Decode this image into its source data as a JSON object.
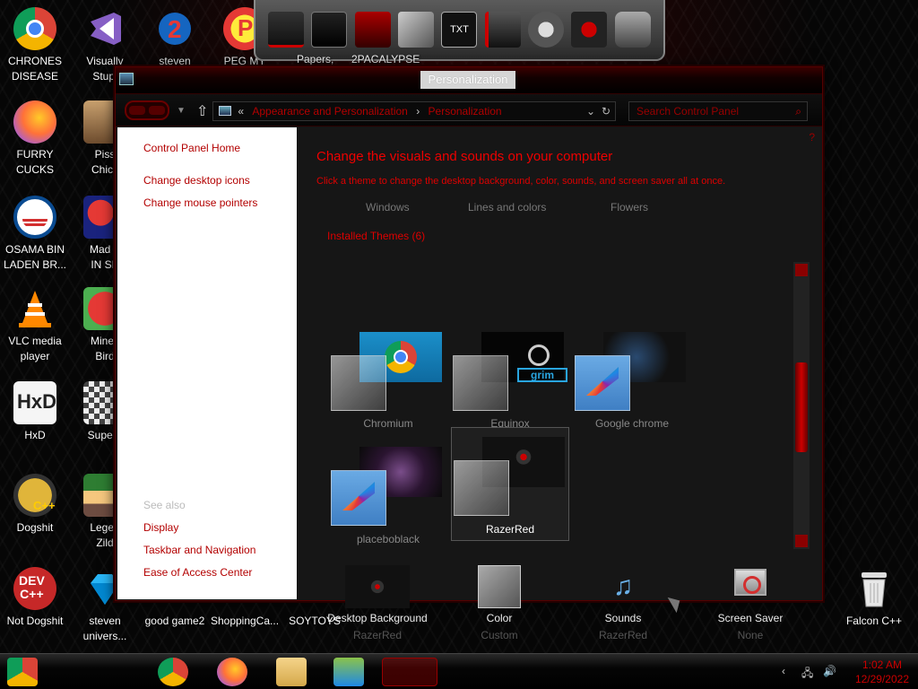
{
  "desktop": {
    "icons": [
      {
        "label": "CHRONES\nDISEASE",
        "icon": "chrome-icon"
      },
      {
        "label": "Visually\nStupi",
        "icon": "visual-studio-icon"
      },
      {
        "label": "steven",
        "icon": "steven-icon"
      },
      {
        "label": "PEG MY",
        "icon": "peg-icon"
      },
      {
        "label": "FURRY\nCUCKS",
        "icon": "firefox-icon"
      },
      {
        "label": "Piss\nChick",
        "icon": "piss-chick-icon"
      },
      {
        "label": "OSAMA BIN\nLADEN BR...",
        "icon": "obama-logo-icon"
      },
      {
        "label": "Mad A\nIN SP",
        "icon": "angry-birds-space-icon"
      },
      {
        "label": "VLC media\nplayer",
        "icon": "vlc-icon"
      },
      {
        "label": "Minec\nBird",
        "icon": "angry-bird-icon"
      },
      {
        "label": "HxD",
        "icon": "hxd-icon"
      },
      {
        "label": "Super I",
        "icon": "super-icon"
      },
      {
        "label": "Dogshit",
        "icon": "dogshit-icon"
      },
      {
        "label": "Legen\nZild",
        "icon": "zelda-icon"
      },
      {
        "label": "Not Dogshit",
        "icon": "dev-cpp-icon"
      },
      {
        "label": "steven\nunivers...",
        "icon": "gem-icon"
      },
      {
        "label": "good game2",
        "icon": "file-icon"
      },
      {
        "label": "ShoppingCa...",
        "icon": "file-icon"
      },
      {
        "label": "SOYTOYS",
        "icon": "file-icon"
      },
      {
        "label": "Falcon C++",
        "icon": "recycle-bin-icon"
      }
    ],
    "dock_labels": [
      "Papers,",
      "2PACALYPSE"
    ]
  },
  "window": {
    "title": "Personalization",
    "breadcrumb": {
      "prefix": "«",
      "items": [
        "Appearance and Personalization",
        "Personalization"
      ]
    },
    "search_placeholder": "Search Control Panel"
  },
  "leftpane": {
    "home": "Control Panel Home",
    "links": [
      "Change desktop icons",
      "Change mouse pointers"
    ],
    "see_also": "See also",
    "see_also_links": [
      "Display",
      "Taskbar and Navigation",
      "Ease of Access Center"
    ]
  },
  "main": {
    "help_icon": "?",
    "heading": "Change the visuals and sounds on your computer",
    "subheading": "Click a theme to change the desktop background, color, sounds, and screen saver all at once.",
    "categories": [
      "Windows",
      "Lines and colors",
      "Flowers"
    ],
    "installed_label": "Installed Themes (6)",
    "themes": [
      {
        "name": "Chromium",
        "selected": false
      },
      {
        "name": "Equinox",
        "selected": false
      },
      {
        "name": "Google chrome",
        "selected": false
      },
      {
        "name": "placeboblack",
        "selected": false
      },
      {
        "name": "RazerRed",
        "selected": true
      }
    ],
    "bottom": [
      {
        "name": "Desktop Background",
        "value": "RazerRed",
        "icon": "desktop-background-icon"
      },
      {
        "name": "Color",
        "value": "Custom",
        "icon": "color-icon"
      },
      {
        "name": "Sounds",
        "value": "RazerRed",
        "icon": "music-notes-icon"
      },
      {
        "name": "Screen Saver",
        "value": "None",
        "icon": "screen-saver-icon"
      }
    ]
  },
  "taskbar": {
    "time": "1:02 AM",
    "date": "12/29/2022"
  },
  "colors": {
    "accent": "#cc0000",
    "window_bg": "#161616"
  }
}
